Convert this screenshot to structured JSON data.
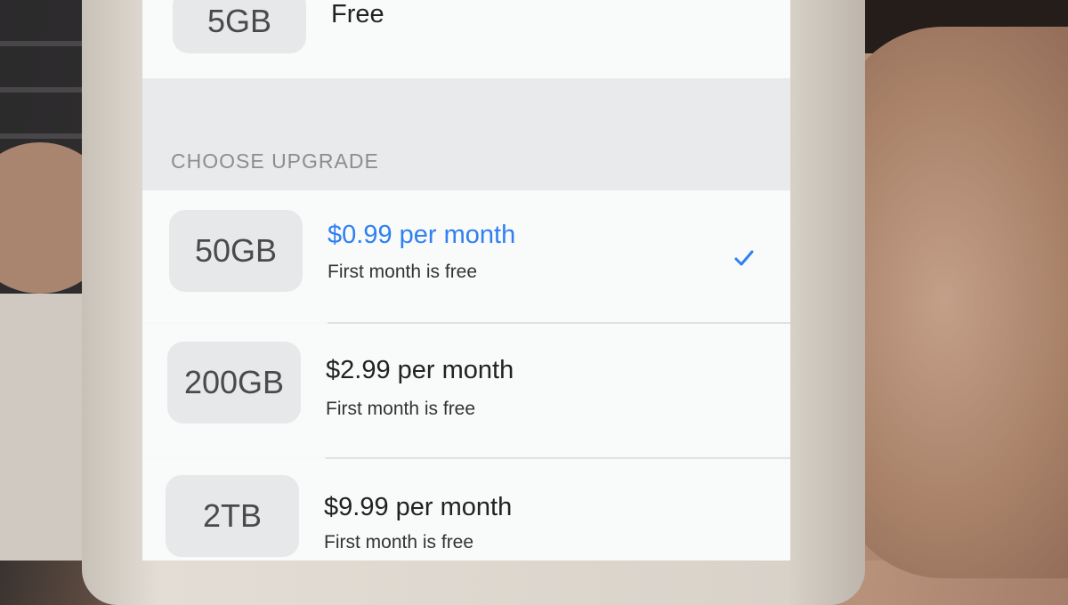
{
  "current_plan": {
    "size": "5GB",
    "price": "Free"
  },
  "upgrade_section": {
    "title": "CHOOSE UPGRADE",
    "options": [
      {
        "size": "50GB",
        "price": "$0.99 per month",
        "note": "First month is free",
        "selected": true
      },
      {
        "size": "200GB",
        "price": "$2.99 per month",
        "note": "First month is free",
        "selected": false
      },
      {
        "size": "2TB",
        "price": "$9.99 per month",
        "note": "First month is free",
        "selected": false
      }
    ]
  },
  "colors": {
    "accent": "#2f80f0",
    "section_text": "#8b8e91",
    "chip_bg": "#e7e8e9"
  },
  "icons": {
    "selected": "checkmark-icon"
  }
}
